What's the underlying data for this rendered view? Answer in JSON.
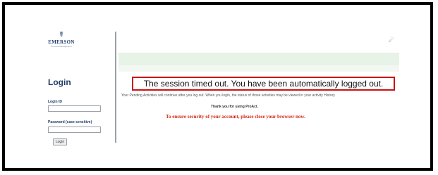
{
  "logo": {
    "mark": "☤",
    "name": "EMERSON",
    "tagline": "Process Management"
  },
  "corner_icon": "☄",
  "login": {
    "title": "Login",
    "id_label": "Login ID",
    "id_value": "",
    "password_label": "Password (case sensitive)",
    "password_value": "",
    "button_label": "Login"
  },
  "main": {
    "session_message": "The session timed out. You have been automatically logged out.",
    "pending_message": "Your Pending Activities will continue after you log out. When you login, the status of those activities may be viewed in your activity History.",
    "thanks_message": "Thank you for using ProAct.",
    "security_message": "To ensure security of your account, please close your browser now."
  },
  "colors": {
    "brand_navy": "#1f3a68",
    "alert_red": "#cc1111",
    "security_text": "#d62a1c",
    "banner_green": "#e8f3e7"
  }
}
